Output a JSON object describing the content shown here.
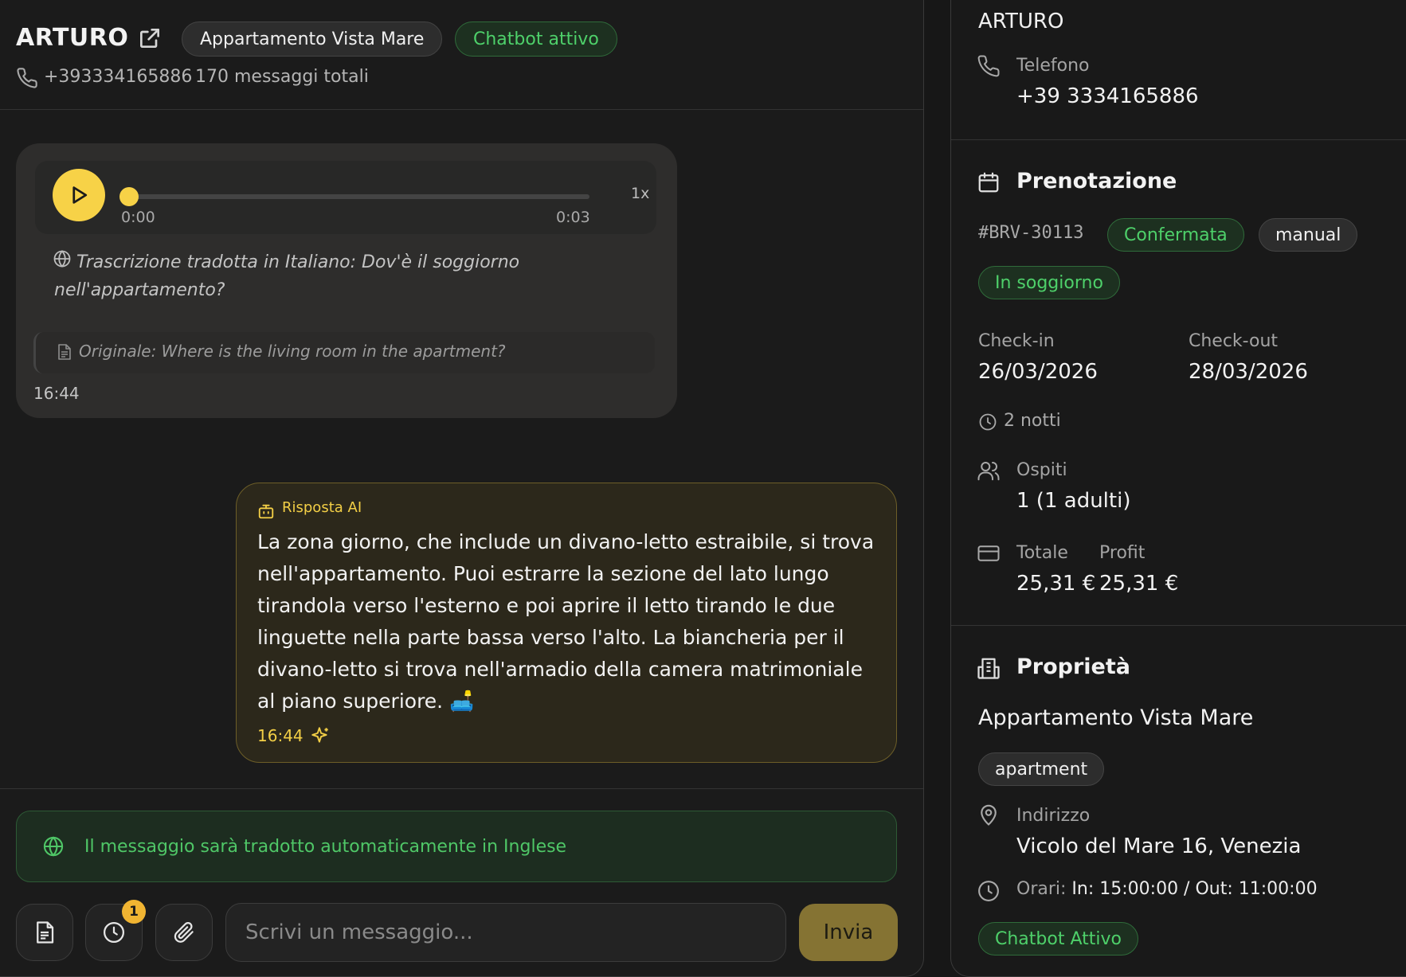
{
  "header": {
    "contact_name": "ARTURO",
    "property_chip": "Appartamento Vista Mare",
    "chatbot_chip": "Chatbot attivo",
    "phone": "+393334165886",
    "message_count": "170 messaggi totali"
  },
  "voice_message": {
    "current_time": "0:00",
    "duration": "0:03",
    "speed": "1x",
    "progress": 0,
    "transcription": "Trascrizione tradotta in Italiano: Dov'è il soggiorno nell'appartamento?",
    "original": "Originale: Where is the living room in the apartment?",
    "time": "16:44"
  },
  "ai_message": {
    "label": "Risposta AI",
    "text": "La zona giorno, che include un divano-letto estraibile, si trova nell'appartamento. Puoi estrarre la sezione del lato lungo tirandola verso l'esterno e poi aprire il letto tirando le due linguette nella parte bassa verso l'alto. La biancheria per il divano-letto si trova nell'armadio della camera matrimoniale al piano superiore. 🛋️",
    "time": "16:44"
  },
  "composer": {
    "translate_notice": "Il messaggio sarà tradotto automaticamente in Inglese",
    "scheduled_badge": "1",
    "placeholder": "Scrivi un messaggio...",
    "send_label": "Invia"
  },
  "sidebar": {
    "guest_name": "ARTURO",
    "phone_label": "Telefono",
    "phone_value": "+39 3334165886",
    "booking": {
      "title": "Prenotazione",
      "code": "#BRV-30113",
      "status": "Confermata",
      "source": "manual",
      "stay_status": "In soggiorno",
      "checkin_label": "Check-in",
      "checkin_value": "26/03/2026",
      "checkout_label": "Check-out",
      "checkout_value": "28/03/2026",
      "nights": "2 notti",
      "guests_label": "Ospiti",
      "guests_value": "1 (1 adulti)",
      "total_label": "Totale",
      "total_value": "25,31 €",
      "profit_label": "Profit",
      "profit_value": "25,31 €"
    },
    "property": {
      "title": "Proprietà",
      "name": "Appartamento Vista Mare",
      "type": "apartment",
      "address_label": "Indirizzo",
      "address_value": "Vicolo del Mare 16, Venezia",
      "hours_label": "Orari:",
      "hours_value": "In: 15:00:00 / Out: 11:00:00",
      "chatbot_chip": "Chatbot Attivo"
    }
  },
  "colors": {
    "accent_yellow": "#f7d247",
    "green": "#4ed06a",
    "background": "#171717"
  }
}
